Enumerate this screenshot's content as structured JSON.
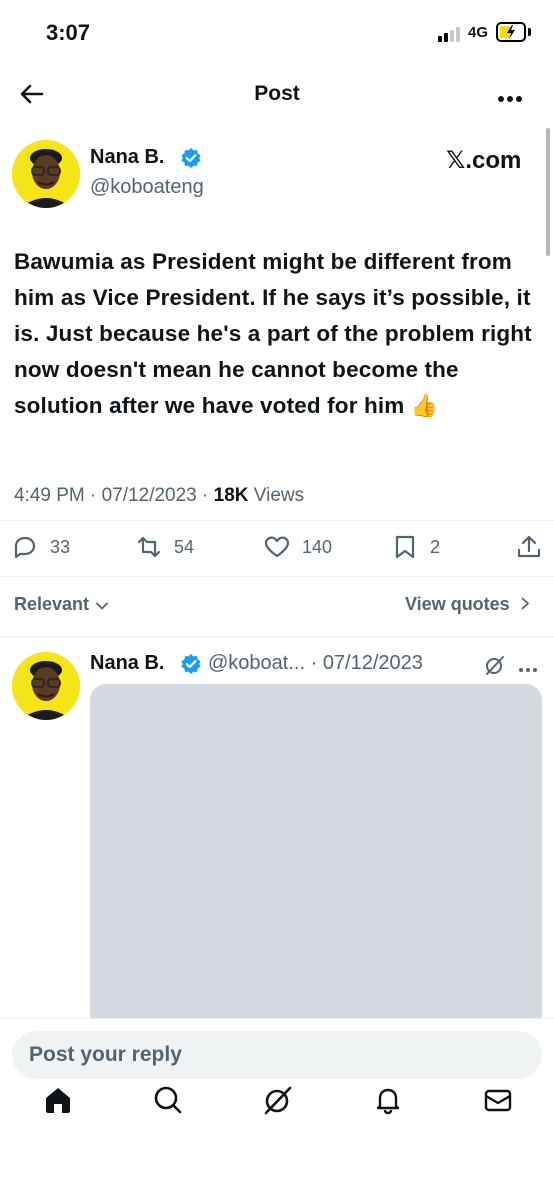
{
  "status_bar": {
    "time": "3:07",
    "network": "4G",
    "battery_color": "#f5d90a"
  },
  "nav": {
    "title": "Post",
    "back_icon": "arrow-left-icon",
    "more_icon": "more-horizontal-icon"
  },
  "post": {
    "author_name": "Nana B.",
    "author_handle": "@koboateng",
    "verified": true,
    "source_label": "𝕏.com",
    "text": "Bawumia as President might be different from him as Vice President. If he says it’s possible, it is. Just because he's a part of the problem right now doesn't mean he cannot become the solution after we have voted for him",
    "emoji": "👍",
    "time": "4:49 PM",
    "date": "07/12/2023",
    "views_count": "18K",
    "views_label": "Views",
    "replies": "33",
    "reposts": "54",
    "likes": "140",
    "bookmarks": "2"
  },
  "sort": {
    "label": "Relevant",
    "view_quotes": "View quotes"
  },
  "reply": {
    "author_name": "Nana B.",
    "author_handle": "@koboat...",
    "date": "07/12/2023"
  },
  "composer": {
    "placeholder": "Post your reply"
  },
  "tabs": [
    {
      "name": "home-icon"
    },
    {
      "name": "search-icon"
    },
    {
      "name": "grok-icon"
    },
    {
      "name": "notifications-icon"
    },
    {
      "name": "messages-icon"
    }
  ],
  "colors": {
    "text": "#0f1419",
    "secondary": "#536471",
    "verified": "#1d9bf0",
    "avatar_bg": "#f5e417",
    "media_placeholder": "#d3d9de",
    "input_bg": "#eff3f4"
  }
}
